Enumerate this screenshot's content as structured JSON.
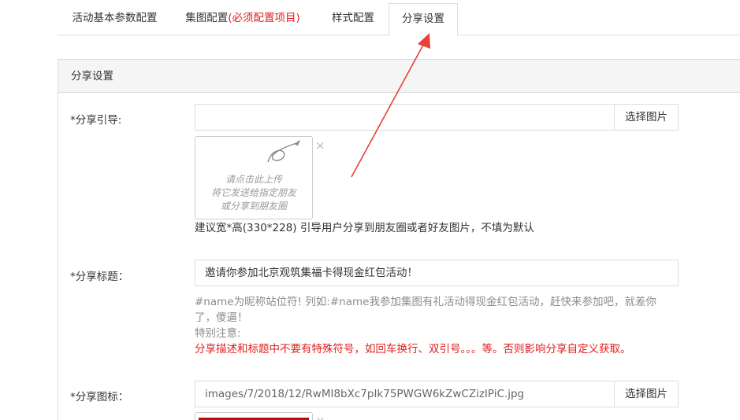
{
  "tabs": [
    {
      "label": "活动基本参数配置"
    },
    {
      "label": "集图配置",
      "required_note": "(必须配置项目)"
    },
    {
      "label": "样式配置"
    },
    {
      "label": "分享设置"
    }
  ],
  "panel": {
    "title": "分享设置"
  },
  "share_guide": {
    "label": "*分享引导:",
    "value": "",
    "button": "选择图片",
    "placeholder_image_text": [
      "请点击此上传",
      "将它发送给指定朋友",
      "或分享到朋友圈"
    ],
    "close": "×",
    "help": "建议宽*高(330*228) 引导用户分享到朋友圈或者好友图片，不填为默认"
  },
  "share_title": {
    "label": "*分享标题：",
    "value": "邀请你参加北京观筑集福卡得现金红包活动！",
    "help_line1": "#name为昵称站位符! 列如:#name我参加集图有礼活动得现金红包活动，赶快来参加吧，就差你",
    "help_line2": "了，傻逼！",
    "help_line3": "特别注意:",
    "warning": "分享描述和标题中不要有特殊符号，如回车换行、双引号。。。等。否则影响分享自定义获取。"
  },
  "share_icon": {
    "label": "*分享图标：",
    "value": "images/7/2018/12/RwMI8bXc7pIk75PWGW6kZwCZizIPiC.jpg",
    "button": "选择图片",
    "close": "×"
  },
  "colors": {
    "accent_red": "#e02020",
    "annotation_arrow": "#e8403a",
    "thumb_bar": "#b90d0d"
  }
}
